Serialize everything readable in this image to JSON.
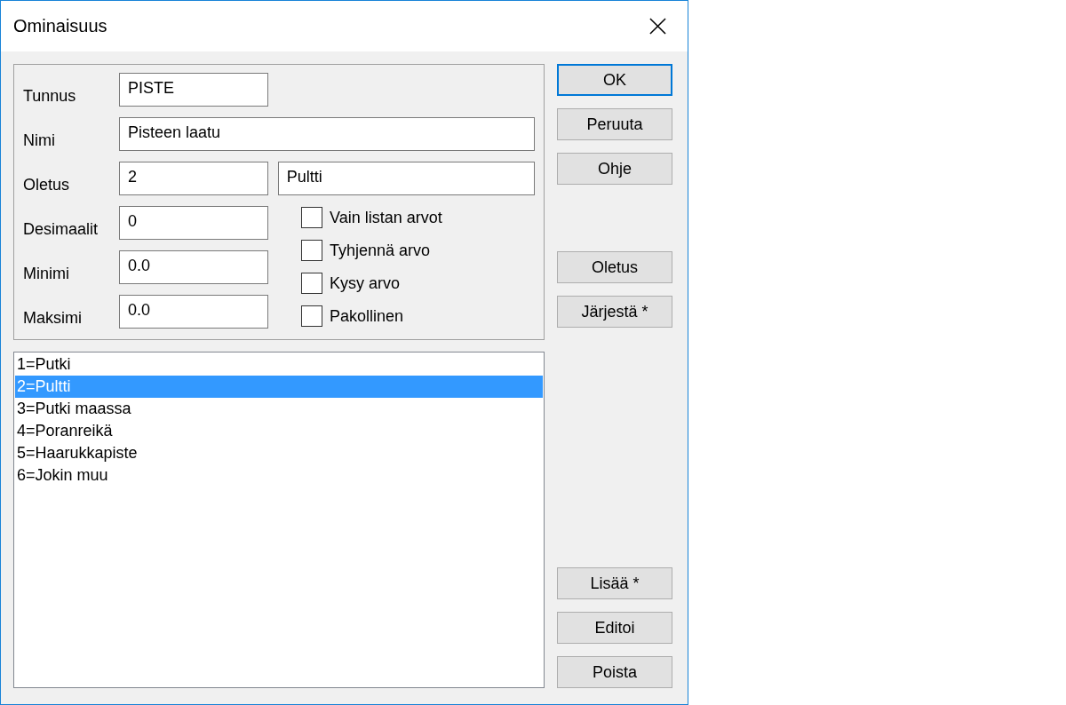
{
  "window": {
    "title": "Ominaisuus"
  },
  "fields": [
    {
      "label": "Tunnus",
      "kind": "short",
      "values": [
        "PISTE"
      ]
    },
    {
      "label": "Nimi",
      "kind": "wide",
      "values": [
        "Pisteen laatu"
      ]
    },
    {
      "label": "Oletus",
      "kind": "pair",
      "values": [
        "2",
        "Pultti"
      ]
    },
    {
      "label": "Desimaalit",
      "kind": "short",
      "values": [
        "0"
      ]
    },
    {
      "label": "Minimi",
      "kind": "short",
      "values": [
        "0.0"
      ]
    },
    {
      "label": "Maksimi",
      "kind": "short",
      "values": [
        "0.0"
      ]
    }
  ],
  "checkboxes": [
    {
      "label": "Vain listan arvot",
      "checked": false
    },
    {
      "label": "Tyhjennä arvo",
      "checked": false
    },
    {
      "label": "Kysy arvo",
      "checked": false
    },
    {
      "label": "Pakollinen",
      "checked": false
    }
  ],
  "list": [
    {
      "text": "1=Putki",
      "selected": false
    },
    {
      "text": "2=Pultti",
      "selected": true
    },
    {
      "text": "3=Putki maassa",
      "selected": false
    },
    {
      "text": "4=Poranreikä",
      "selected": false
    },
    {
      "text": "5=Haarukkapiste",
      "selected": false
    },
    {
      "text": "6=Jokin muu",
      "selected": false
    }
  ],
  "buttons_top": [
    {
      "label": "OK",
      "default": true
    },
    {
      "label": "Peruuta",
      "default": false
    },
    {
      "label": "Ohje",
      "default": false
    }
  ],
  "buttons_middle": [
    {
      "label": "Oletus",
      "default": false
    },
    {
      "label": "Järjestä *",
      "default": false
    }
  ],
  "buttons_bottom": [
    {
      "label": "Lisää *",
      "default": false
    },
    {
      "label": "Editoi",
      "default": false
    },
    {
      "label": "Poista",
      "default": false
    }
  ]
}
